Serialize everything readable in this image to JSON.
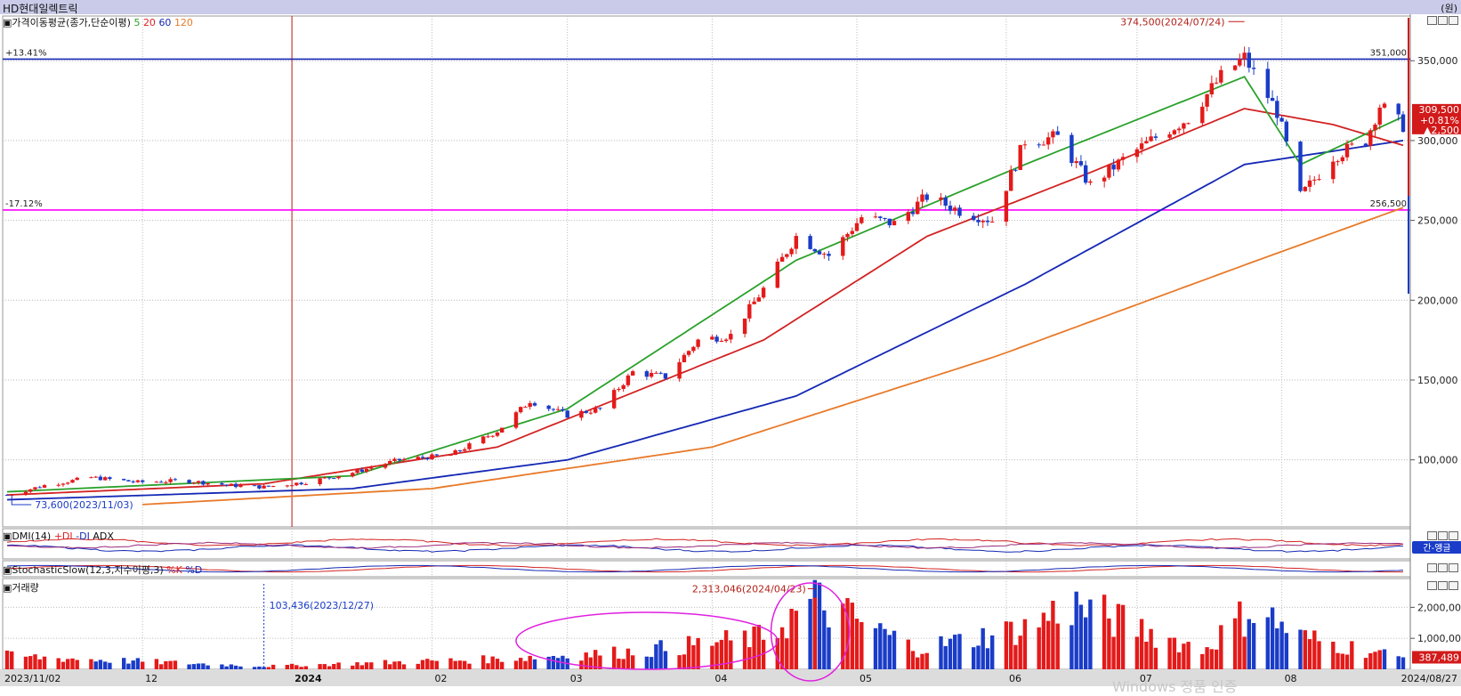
{
  "window": {
    "title": "HD현대일렉트릭",
    "unit": "(원)"
  },
  "price_panel": {
    "label_prefix": "가격이동평균(종가,단순이평)",
    "ma_periods": [
      "5",
      "20",
      "60",
      "120"
    ],
    "ma_colors": [
      "#2aa12a",
      "#d22222",
      "#1428b4",
      "#e87a2a"
    ],
    "upper_line_pct": "+13.41%",
    "upper_line_value": "351,000",
    "lower_line_pct": "-17.12%",
    "lower_line_value": "256,500",
    "high_annotation": "374,500(2024/07/24)",
    "low_annotation": "73,600(2023/11/03)",
    "current_price": "309,500",
    "change_pct": "+0.81%",
    "change_abs": "▲2,500"
  },
  "dmi_panel": {
    "label": "DMI(14)",
    "plus_di": "+DI",
    "minus_di": "-DI",
    "adx": "ADX",
    "tag": "간-얭글"
  },
  "stoch_panel": {
    "label": "StochasticSlow(12,3,지수이평,3)",
    "k": "%K",
    "d": "%D"
  },
  "volume_panel": {
    "label": "거래량",
    "annotation_dec": "103,436(2023/12/27)",
    "annotation_apr": "2,313,046(2024/04/23)",
    "current_volume": "387,489"
  },
  "x_axis": {
    "labels": [
      "2023/11/02",
      "12",
      "2024",
      "02",
      "03",
      "04",
      "05",
      "06",
      "07",
      "08",
      "2024/08/27"
    ]
  },
  "watermark": "Windows 정품 인증",
  "chart_data": {
    "type": "candlestick",
    "y_axis_ticks": [
      100000,
      150000,
      200000,
      250000,
      300000,
      350000
    ],
    "y_axis_tick_labels": [
      "100,000",
      "150,000",
      "200,000",
      "250,000",
      "300,000",
      "350,000"
    ],
    "ylim": [
      58000,
      378000
    ],
    "volume_ticks": [
      "1,000,000",
      "2,000,000"
    ],
    "horizontal_lines": [
      {
        "value": 351000,
        "color": "#1428b4"
      },
      {
        "value": 256500,
        "color": "#ff00ff"
      }
    ],
    "x_date_range": [
      "2023/11/02",
      "2024/08/27"
    ],
    "price_keyframes": [
      [
        "2023/11/02",
        78000
      ],
      [
        "2023/11/10",
        84000
      ],
      [
        "2023/11/20",
        89000
      ],
      [
        "2023/11/30",
        86000
      ],
      [
        "2023/12/10",
        87000
      ],
      [
        "2023/12/20",
        84000
      ],
      [
        "2023/12/27",
        83000
      ],
      [
        "2024/01/05",
        86000
      ],
      [
        "2024/01/15",
        92000
      ],
      [
        "2024/01/25",
        100000
      ],
      [
        "2024/02/05",
        103000
      ],
      [
        "2024/02/15",
        118000
      ],
      [
        "2024/02/22",
        137000
      ],
      [
        "2024/03/01",
        128000
      ],
      [
        "2024/03/08",
        132000
      ],
      [
        "2024/03/15",
        155000
      ],
      [
        "2024/03/22",
        152000
      ],
      [
        "2024/03/29",
        175000
      ],
      [
        "2024/04/05",
        178000
      ],
      [
        "2024/04/12",
        207000
      ],
      [
        "2024/04/19",
        240000
      ],
      [
        "2024/04/26",
        228000
      ],
      [
        "2024/05/03",
        252000
      ],
      [
        "2024/05/10",
        248000
      ],
      [
        "2024/05/17",
        265000
      ],
      [
        "2024/05/24",
        256000
      ],
      [
        "2024/05/31",
        250000
      ],
      [
        "2024/06/07",
        300000
      ],
      [
        "2024/06/14",
        302000
      ],
      [
        "2024/06/21",
        272000
      ],
      [
        "2024/06/28",
        288000
      ],
      [
        "2024/07/05",
        302000
      ],
      [
        "2024/07/12",
        314000
      ],
      [
        "2024/07/19",
        340000
      ],
      [
        "2024/07/24",
        352000
      ],
      [
        "2024/07/31",
        318000
      ],
      [
        "2024/08/05",
        265000
      ],
      [
        "2024/08/12",
        290000
      ],
      [
        "2024/08/19",
        300000
      ],
      [
        "2024/08/22",
        322000
      ],
      [
        "2024/08/27",
        309500
      ]
    ],
    "ma_keyframes": {
      "ma5": [
        [
          "2023/11/02",
          80000
        ],
        [
          "2024/01/15",
          90000
        ],
        [
          "2024/03/01",
          132000
        ],
        [
          "2024/04/19",
          225000
        ],
        [
          "2024/06/07",
          285000
        ],
        [
          "2024/07/24",
          340000
        ],
        [
          "2024/08/05",
          285000
        ],
        [
          "2024/08/27",
          315000
        ]
      ],
      "ma20": [
        [
          "2023/11/02",
          78000
        ],
        [
          "2023/12/27",
          85000
        ],
        [
          "2024/02/15",
          108000
        ],
        [
          "2024/04/12",
          175000
        ],
        [
          "2024/05/17",
          240000
        ],
        [
          "2024/06/21",
          280000
        ],
        [
          "2024/07/24",
          320000
        ],
        [
          "2024/08/12",
          310000
        ],
        [
          "2024/08/27",
          297000
        ]
      ],
      "ma60": [
        [
          "2023/11/02",
          75000
        ],
        [
          "2024/01/15",
          82000
        ],
        [
          "2024/03/01",
          100000
        ],
        [
          "2024/04/19",
          140000
        ],
        [
          "2024/06/07",
          210000
        ],
        [
          "2024/07/24",
          285000
        ],
        [
          "2024/08/27",
          300000
        ]
      ],
      "ma120": [
        [
          "2023/12/01",
          72000
        ],
        [
          "2024/02/01",
          82000
        ],
        [
          "2024/04/01",
          108000
        ],
        [
          "2024/06/01",
          165000
        ],
        [
          "2024/07/24",
          222000
        ],
        [
          "2024/08/27",
          258000
        ]
      ]
    },
    "volume_keyframes": [
      [
        "2023/11/02",
        450000
      ],
      [
        "2023/12/27",
        103436
      ],
      [
        "2024/02/15",
        350000
      ],
      [
        "2024/03/15",
        600000
      ],
      [
        "2024/04/12",
        1100000
      ],
      [
        "2024/04/23",
        2313046
      ],
      [
        "2024/05/15",
        700000
      ],
      [
        "2024/06/07",
        1400000
      ],
      [
        "2024/06/17",
        2200000
      ],
      [
        "2024/07/15",
        650000
      ],
      [
        "2024/07/26",
        2100000
      ],
      [
        "2024/08/05",
        1100000
      ],
      [
        "2024/08/27",
        387489
      ]
    ]
  }
}
